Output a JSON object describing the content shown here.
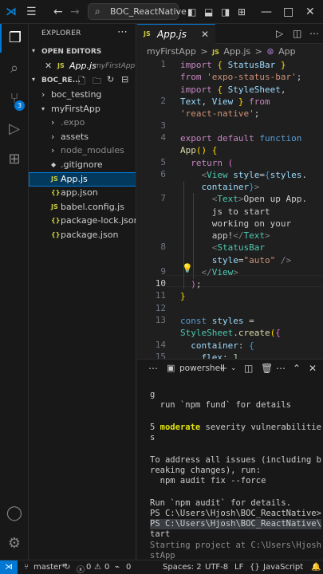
{
  "titlebar": {
    "search_text": "BOC_ReactNative",
    "icons": [
      "vscode-logo-icon",
      "menu-icon",
      "back-icon",
      "forward-icon",
      "search-icon",
      "toggle-sidebar-icon",
      "toggle-panel-icon",
      "toggle-secondary-icon",
      "layout-icon",
      "minimize-icon",
      "close-icon"
    ]
  },
  "activitybar": {
    "items": [
      "explorer",
      "search",
      "source-control",
      "run-debug",
      "extensions"
    ],
    "scm_badge": "3",
    "bottom": [
      "accounts",
      "manage"
    ]
  },
  "explorer": {
    "title": "EXPLORER",
    "open_editors_label": "OPEN EDITORS",
    "open_file_name": "App.js",
    "open_file_folder": "myFirstApp",
    "project_label": "BOC_RE...",
    "tree": [
      {
        "label": "boc_testing",
        "type": "folder",
        "expanded": false,
        "indent": 1
      },
      {
        "label": "myFirstApp",
        "type": "folder",
        "expanded": true,
        "indent": 1
      },
      {
        "label": ".expo",
        "type": "folder",
        "expanded": false,
        "indent": 2,
        "dim": true
      },
      {
        "label": "assets",
        "type": "folder",
        "expanded": false,
        "indent": 2
      },
      {
        "label": "node_modules",
        "type": "folder",
        "expanded": false,
        "indent": 2,
        "dim": true
      },
      {
        "label": ".gitignore",
        "type": "git",
        "indent": 2
      },
      {
        "label": "App.js",
        "type": "js",
        "indent": 2,
        "selected": true
      },
      {
        "label": "app.json",
        "type": "json",
        "indent": 2
      },
      {
        "label": "babel.config.js",
        "type": "js",
        "indent": 2
      },
      {
        "label": "package-lock.json",
        "type": "json",
        "indent": 2
      },
      {
        "label": "package.json",
        "type": "json",
        "indent": 2
      }
    ],
    "js_icon": "JS",
    "json_icon": "{}"
  },
  "editor": {
    "tab_label": "App.js",
    "breadcrumb": [
      "myFirstApp",
      ">",
      "JS",
      "App.js",
      ">",
      "App"
    ],
    "line_numbers": [
      "1",
      "2",
      "3",
      "4",
      "5",
      "6",
      "7",
      "8",
      "9",
      "10",
      "11",
      "12",
      "13",
      "14",
      "15"
    ],
    "current_line": "10"
  },
  "terminal": {
    "tab_label": "powershell",
    "lines": [
      "g",
      "  run `npm fund` for details",
      "",
      "5 moderate severity vulnerabilitie",
      "s",
      "",
      "To address all issues (including b",
      "reaking changes), run:",
      "  npm audit fix --force",
      "",
      "Run `npm audit` for details.",
      "PS C:\\Users\\Hjosh\\BOC_ReactNative>",
      "PS C:\\Users\\Hjosh\\BOC_ReactNative\\",
      "tart",
      "Starting project at C:\\Users\\Hjosh",
      "stApp"
    ]
  },
  "statusbar": {
    "branch": "master*",
    "errors": "0",
    "warnings": "0",
    "ports": "0",
    "spaces": "Spaces: 2",
    "encoding": "UTF-8",
    "eol": "LF",
    "language": "JavaScript"
  }
}
